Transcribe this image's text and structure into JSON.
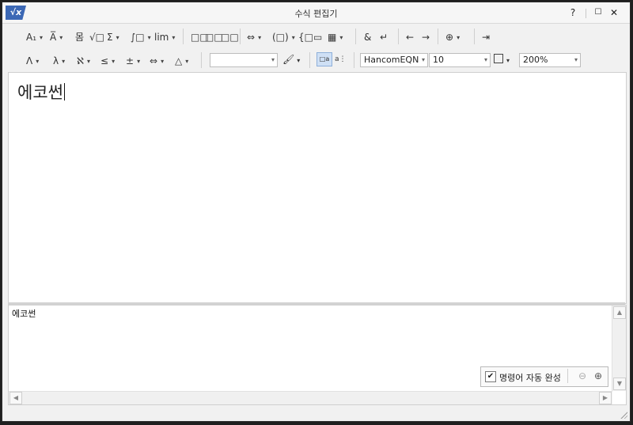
{
  "window": {
    "app_icon": "√x",
    "title": "수식 편집기",
    "help_label": "?",
    "maximize_label": "☐",
    "close_label": "✕"
  },
  "toolbar_row1": [
    {
      "name": "subscript-superscript-tool",
      "label": "A₁",
      "dropdown": true
    },
    {
      "name": "decoration-tool",
      "label": "A̅",
      "dropdown": true
    },
    {
      "name": "fraction-tool",
      "label": "몸",
      "dropdown": false
    },
    {
      "name": "root-tool",
      "label": "√□",
      "dropdown": false
    },
    {
      "name": "sum-tool",
      "label": "Σ",
      "dropdown": true
    },
    {
      "name": "integral-tool",
      "label": "∫□",
      "dropdown": true
    },
    {
      "name": "limit-tool",
      "label": "lim",
      "dropdown": true
    },
    {
      "name": "matrix-tool-1",
      "label": "□□",
      "dropdown": false
    },
    {
      "name": "matrix-tool-2",
      "label": "□□",
      "dropdown": false
    },
    {
      "name": "matrix-tool-3",
      "label": "□□",
      "dropdown": false
    },
    {
      "name": "arrow-tool",
      "label": "⇔",
      "dropdown": true
    },
    {
      "name": "bracket-tool",
      "label": "(□)",
      "dropdown": true
    },
    {
      "name": "brace-tool",
      "label": "{□",
      "dropdown": false
    },
    {
      "name": "column-tool",
      "label": "▭",
      "dropdown": false
    },
    {
      "name": "grid-tool",
      "label": "▦",
      "dropdown": true
    },
    {
      "name": "ampersand-tool",
      "label": "&",
      "dropdown": false
    },
    {
      "name": "newline-tool",
      "label": "↵",
      "dropdown": false
    },
    {
      "name": "move-left-tool",
      "label": "←",
      "dropdown": false
    },
    {
      "name": "move-right-tool",
      "label": "→",
      "dropdown": false
    },
    {
      "name": "insert-tool",
      "label": "⊕",
      "dropdown": true
    },
    {
      "name": "exit-tool",
      "label": "⇥",
      "dropdown": false
    }
  ],
  "toolbar_row2": [
    {
      "name": "greek-upper-tool",
      "label": "Λ",
      "dropdown": true
    },
    {
      "name": "greek-lower-tool",
      "label": "λ",
      "dropdown": true
    },
    {
      "name": "hebrew-tool",
      "label": "ℵ",
      "dropdown": true
    },
    {
      "name": "relation-tool",
      "label": "≤",
      "dropdown": true
    },
    {
      "name": "operator-tool",
      "label": "±",
      "dropdown": true
    },
    {
      "name": "arrow-symbol-tool",
      "label": "⇔",
      "dropdown": true
    },
    {
      "name": "misc-symbol-tool",
      "label": "△",
      "dropdown": true
    }
  ],
  "style_combo": {
    "value": ""
  },
  "font_combo": {
    "value": "HancomEQN"
  },
  "size_combo": {
    "value": "10"
  },
  "zoom_combo": {
    "value": "200%"
  },
  "editor": {
    "formula_text": "에코썬"
  },
  "script_pane": {
    "text": "에코썬"
  },
  "autocomplete": {
    "checked": true,
    "check_mark": "✔",
    "label": "명령어 자동 완성",
    "zoom_out": "⊖",
    "zoom_in": "⊕"
  }
}
